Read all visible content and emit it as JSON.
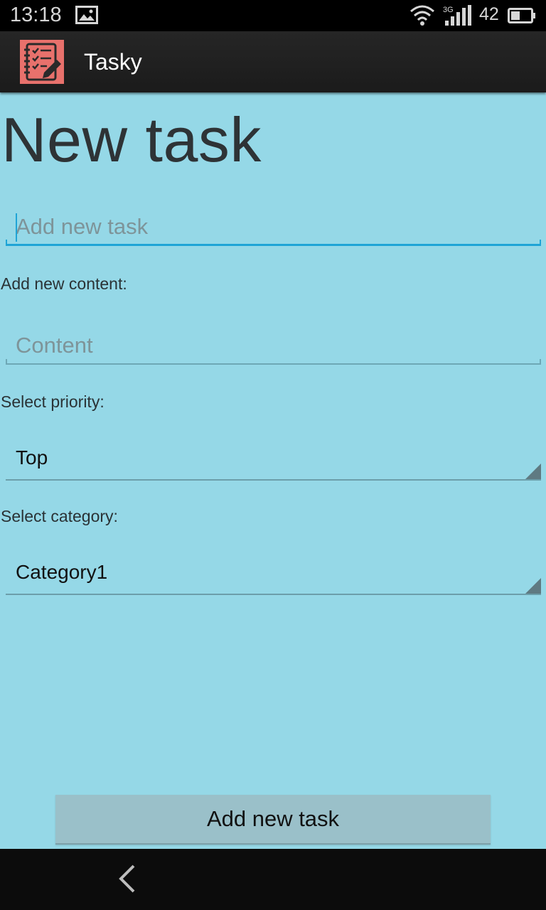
{
  "status_bar": {
    "time": "13:18",
    "network": "3G",
    "battery_level": "42",
    "icons": [
      "image-icon",
      "wifi-icon",
      "signal-icon",
      "battery-icon"
    ]
  },
  "action_bar": {
    "app_icon": "notebook-edit-icon",
    "title": "Tasky"
  },
  "form": {
    "page_title": "New task",
    "task_input": {
      "value": "",
      "placeholder": "Add new task"
    },
    "content_label": "Add new content:",
    "content_input": {
      "value": "",
      "placeholder": "Content"
    },
    "priority_label": "Select priority:",
    "priority_selected": "Top",
    "category_label": "Select category:",
    "category_selected": "Category1",
    "submit_label": "Add new task"
  },
  "nav_bar": {
    "back_icon": "back-icon"
  },
  "colors": {
    "background": "#95d8e7",
    "accent": "#1fa4d6",
    "button": "#9ac0c9",
    "app_icon": "#e8716c"
  }
}
